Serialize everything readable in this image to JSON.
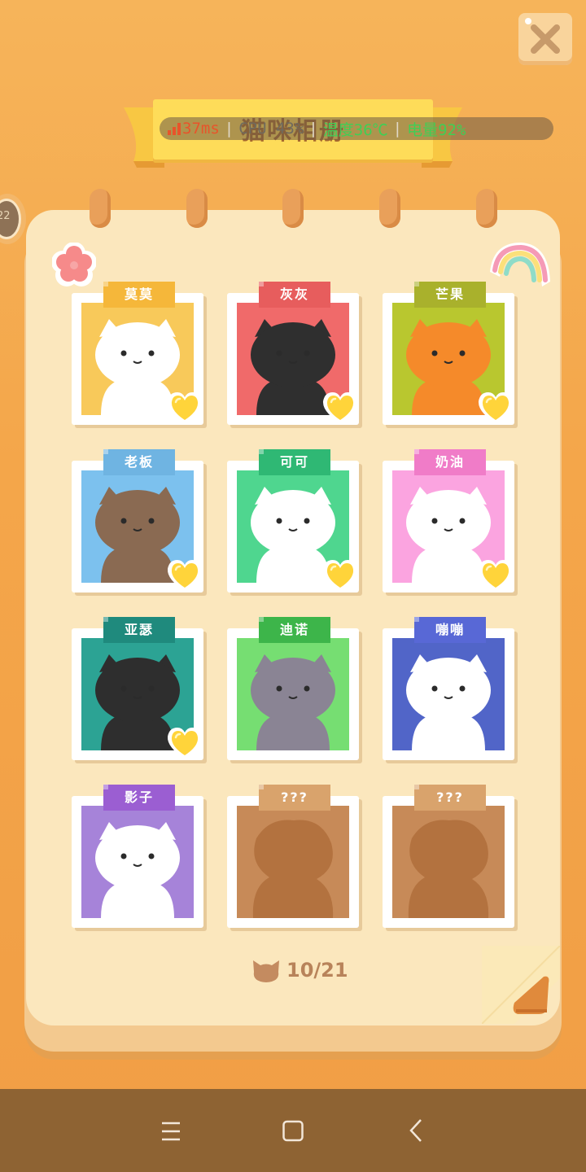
{
  "title": "猫咪相册",
  "status": {
    "ping": "37ms",
    "middle": "CPU  43%",
    "temperature": "温度36℃",
    "battery": "电量92%"
  },
  "side_badge": "22",
  "cats": [
    {
      "name": "莫莫",
      "tag_color": "#f5b73a",
      "bg": "#f8c95a",
      "unlocked": true,
      "favorite": true
    },
    {
      "name": "灰灰",
      "tag_color": "#e75d5d",
      "bg": "#f06a6a",
      "unlocked": true,
      "favorite": true
    },
    {
      "name": "芒果",
      "tag_color": "#a9b12c",
      "bg": "#b9c72f",
      "unlocked": true,
      "favorite": true
    },
    {
      "name": "老板",
      "tag_color": "#6fb4e2",
      "bg": "#7cc1ee",
      "unlocked": true,
      "favorite": true
    },
    {
      "name": "可可",
      "tag_color": "#2fb874",
      "bg": "#4fd68f",
      "unlocked": true,
      "favorite": true
    },
    {
      "name": "奶油",
      "tag_color": "#f07cc8",
      "bg": "#fba4e0",
      "unlocked": true,
      "favorite": true
    },
    {
      "name": "亚瑟",
      "tag_color": "#1f8a7d",
      "bg": "#2ca394",
      "unlocked": true,
      "favorite": true
    },
    {
      "name": "迪诺",
      "tag_color": "#3db54a",
      "bg": "#76de72",
      "unlocked": true,
      "favorite": false
    },
    {
      "name": "嘣嘣",
      "tag_color": "#5868d6",
      "bg": "#5165c8",
      "unlocked": true,
      "favorite": false
    },
    {
      "name": "影子",
      "tag_color": "#9b5ed2",
      "bg": "#a683d9",
      "unlocked": true,
      "favorite": false
    },
    {
      "name": "???",
      "tag_color": "#d9a36c",
      "bg": "#c78a58",
      "unlocked": false,
      "favorite": false
    },
    {
      "name": "???",
      "tag_color": "#d9a36c",
      "bg": "#c78a58",
      "unlocked": false,
      "favorite": false
    }
  ],
  "progress": {
    "count": "10/21",
    "collected": 10,
    "total": 21
  },
  "icons": {
    "close": "close-icon",
    "heart": "heart-icon",
    "cat_head": "cat-head-icon",
    "menu": "menu-icon",
    "home": "home-icon",
    "back": "back-icon"
  }
}
